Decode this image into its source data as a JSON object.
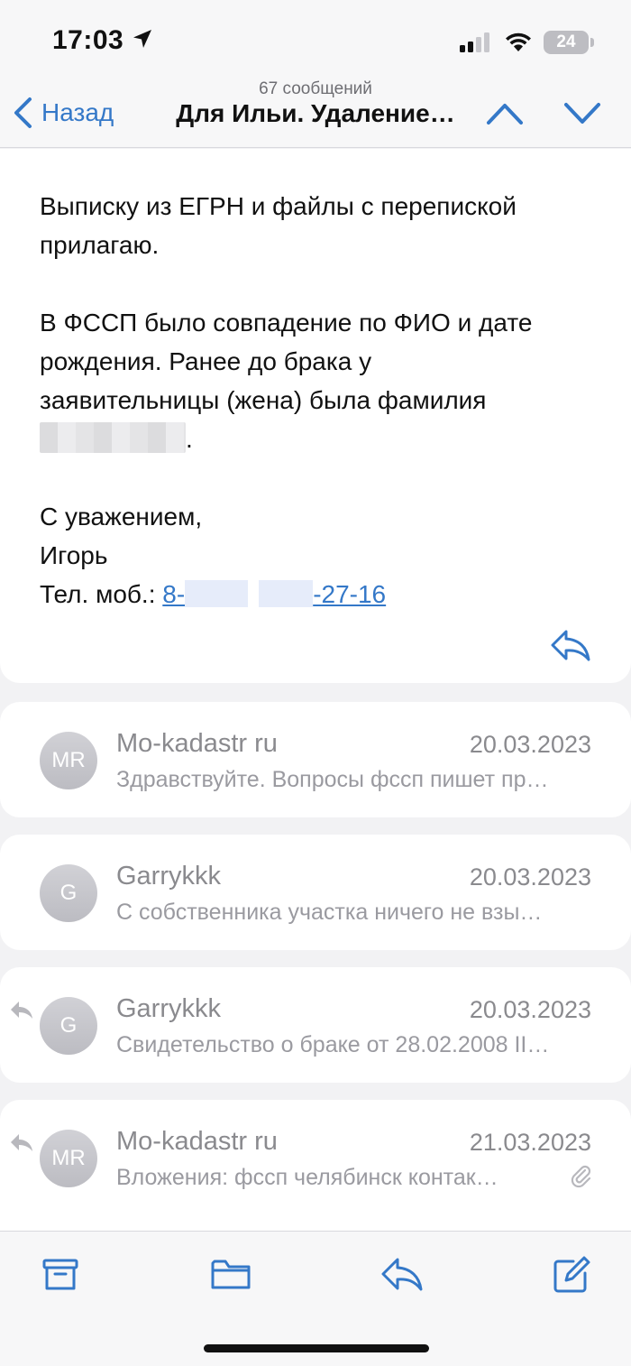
{
  "status_bar": {
    "time": "17:03",
    "battery": "24",
    "icons": [
      "location-arrow-icon",
      "cellular-signal-icon",
      "wifi-icon",
      "battery-icon"
    ]
  },
  "nav": {
    "back_label": "Назад",
    "message_count": "67 сообщений",
    "title": "Для Ильи. Удаление…",
    "icons": [
      "chevron-left-icon",
      "chevron-up-icon",
      "chevron-down-icon"
    ]
  },
  "email_body": {
    "para1_line1": "Выписку из ЕГРН и файлы с перепиской",
    "para1_line2": "прилагаю.",
    "para2_line1": "В ФССП было совпадение по ФИО и дате",
    "para2_line2": "рождения. Ранее до брака у",
    "para2_line3": "заявительницы (жена) была фамилия",
    "para2_end": ".",
    "sign_greeting": "С уважением,",
    "sign_name": "Игорь",
    "phone_label": "Тел. моб.: ",
    "phone_prefix": "8-",
    "phone_dash": "-",
    "phone_suffix": "27-16"
  },
  "thread": [
    {
      "initials": "MR",
      "sender": "Mo-kadastr ru",
      "date": "20.03.2023",
      "preview": "Здравствуйте. Вопросы фссп пишет пр…",
      "replied": false,
      "attachment": false
    },
    {
      "initials": "G",
      "sender": "Garrykkk",
      "date": "20.03.2023",
      "preview": "С собственника участка ничего не взы…",
      "replied": false,
      "attachment": false
    },
    {
      "initials": "G",
      "sender": "Garrykkk",
      "date": "20.03.2023",
      "preview": "Свидетельство о браке от 28.02.2008 II…",
      "replied": true,
      "attachment": false
    },
    {
      "initials": "MR",
      "sender": "Mo-kadastr ru",
      "date": "21.03.2023",
      "preview": "Вложения: фссп челябинск контак…",
      "replied": true,
      "attachment": true
    }
  ],
  "toolbar": {
    "icons": [
      "archive-icon",
      "folder-icon",
      "reply-icon",
      "compose-icon"
    ]
  },
  "colors": {
    "accent": "#3478c8",
    "background": "#f2f2f4",
    "card": "#ffffff",
    "secondary_text": "#8a8a8e"
  }
}
